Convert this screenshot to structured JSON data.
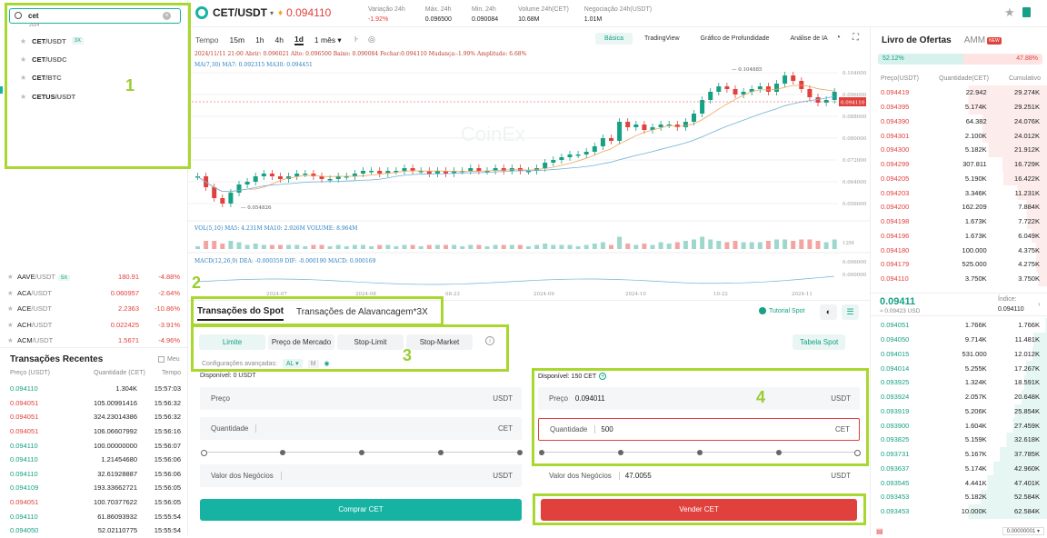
{
  "header": {
    "pair": "CET/USDT",
    "price": "0.094110",
    "stats": [
      {
        "label": "Variação 24h",
        "value": "-1.92%",
        "color": "red"
      },
      {
        "label": "Máx. 24h",
        "value": "0.096500",
        "color": ""
      },
      {
        "label": "Min. 24h",
        "value": "0.090084",
        "color": ""
      },
      {
        "label": "Volume 24h(CET)",
        "value": "10.68M",
        "color": ""
      },
      {
        "label": "Negociação 24h(USDT)",
        "value": "1.01M",
        "color": ""
      }
    ]
  },
  "search": {
    "value": "cet",
    "hint": "2024",
    "results": [
      {
        "base": "CET",
        "quote": "/USDT",
        "badge": "3X"
      },
      {
        "base": "CET",
        "quote": "/USDC",
        "badge": ""
      },
      {
        "base": "CET",
        "quote": "/BTC",
        "badge": ""
      },
      {
        "base": "CETUS",
        "quote": "/USDT",
        "badge": ""
      }
    ]
  },
  "markets": [
    {
      "pair": "AAVE",
      "quote": "/USDT",
      "badge": "5X",
      "price": "180.91",
      "change": "-4.88%"
    },
    {
      "pair": "ACA",
      "quote": "/USDT",
      "badge": "",
      "price": "0.060957",
      "change": "-2.64%"
    },
    {
      "pair": "ACE",
      "quote": "/USDT",
      "badge": "",
      "price": "2.2363",
      "change": "-10.86%"
    },
    {
      "pair": "ACH",
      "quote": "/USDT",
      "badge": "",
      "price": "0.022425",
      "change": "-3.91%"
    },
    {
      "pair": "ACM",
      "quote": "/USDT",
      "badge": "",
      "price": "1.5671",
      "change": "-4.96%"
    }
  ],
  "recent": {
    "title": "Transações Recentes",
    "mine": "Meu",
    "cols": [
      "Preço (USDT)",
      "Quantidade (CET)",
      "Tempo"
    ],
    "rows": [
      [
        "0.094110",
        "1.304K",
        "15:57:03",
        "g"
      ],
      [
        "0.094051",
        "105.00991416",
        "15:56:32",
        "r"
      ],
      [
        "0.094051",
        "324.23014386",
        "15:56:32",
        "r"
      ],
      [
        "0.094051",
        "106.06607992",
        "15:56:16",
        "r"
      ],
      [
        "0.094110",
        "100.00000000",
        "15:56:07",
        "g"
      ],
      [
        "0.094110",
        "1.21454680",
        "15:56:06",
        "g"
      ],
      [
        "0.094110",
        "32.61928887",
        "15:56:06",
        "g"
      ],
      [
        "0.094109",
        "193.33662721",
        "15:56:05",
        "g"
      ],
      [
        "0.094051",
        "100.70377622",
        "15:56:05",
        "r"
      ],
      [
        "0.094110",
        "61.86093932",
        "15:55:54",
        "g"
      ],
      [
        "0.094050",
        "52.02110775",
        "15:55:54",
        "g"
      ]
    ]
  },
  "chart": {
    "tabs_left": [
      "Tempo",
      "15m",
      "1h",
      "4h",
      "1d",
      "1 mês ▾"
    ],
    "tabs_right": [
      "Básica",
      "TradingView",
      "Gráfico de Profundidade",
      "Análise de IA"
    ],
    "info": "2024/11/11 21:00  Abrir: 0.096021  Alto: 0.096500  Baixo: 0.090084  Fechar:0.094110  Mudança:-1.99%  Amplitude: 6.68%",
    "ma": "MA(7,30)  MA7: 0.092315  MA30: 0.094451",
    "vol": "VOL(5,10)  MA5: 4.231M  MA10: 2.926M  VOLUME: 8.964M",
    "macd": "MACD(12,26,9)  DEA: -0.000359  DIF: -0.000190  MACD: 0.000169",
    "hi": "0.104885",
    "lo": "0.054826",
    "last": "0.094110",
    "watermark": "CoinEx",
    "volmax": "12M",
    "yticks": [
      "0.104000",
      "0.096000",
      "0.088000",
      "0.080000",
      "0.072000",
      "0.064000",
      "0.056000"
    ],
    "macdticks": [
      "0.006000",
      "0.000000"
    ],
    "xticks": [
      "2024-07",
      "2024-08",
      "08-23",
      "2024-09",
      "2024-10",
      "10-22",
      "2024-11"
    ]
  },
  "trade": {
    "tabs": [
      "Transações do Spot",
      "Transações de Alavancagem*3X"
    ],
    "tutorial": "Tutorial Spot",
    "order_types": [
      "Limite",
      "Preço de Mercado",
      "Stop-Limit",
      "Stop-Market"
    ],
    "advanced": "Configurações avançadas:",
    "adv_sel": "AL",
    "adv_m": "M",
    "table_btn": "Tabela Spot",
    "buy": {
      "avail": "Disponível: 0 USDT",
      "price_label": "Preço",
      "price_unit": "USDT",
      "qty_label": "Quantidade",
      "qty_unit": "CET",
      "value_label": "Valor dos Negócios",
      "value_unit": "USDT",
      "button": "Comprar CET"
    },
    "sell": {
      "avail": "Disponível: 150 CET",
      "price_label": "Preço",
      "price": "0.094011",
      "price_unit": "USDT",
      "qty_label": "Quantidade",
      "qty": "500",
      "qty_unit": "CET",
      "value_label": "Valor dos Negócios",
      "value": "47.0055",
      "value_unit": "USDT",
      "button": "Vender CET"
    }
  },
  "orderbook": {
    "title": "Livro de Ofertas",
    "amm": "AMM",
    "amm_badge": "NEW",
    "buy_pct": "52.12%",
    "sell_pct": "47.88%",
    "cols": [
      "Preço(USDT)",
      "Quantidade(CET)",
      "Cumulativo"
    ],
    "asks": [
      [
        "0.094419",
        "22.942",
        "29.274K"
      ],
      [
        "0.094395",
        "5.174K",
        "29.251K"
      ],
      [
        "0.094390",
        "64.382",
        "24.076K"
      ],
      [
        "0.094301",
        "2.100K",
        "24.012K"
      ],
      [
        "0.094300",
        "5.182K",
        "21.912K"
      ],
      [
        "0.094299",
        "307.811",
        "16.729K"
      ],
      [
        "0.094205",
        "5.190K",
        "16.422K"
      ],
      [
        "0.094203",
        "3.346K",
        "11.231K"
      ],
      [
        "0.094200",
        "162.209",
        "7.884K"
      ],
      [
        "0.094198",
        "1.673K",
        "7.722K"
      ],
      [
        "0.094196",
        "1.673K",
        "6.049K"
      ],
      [
        "0.094180",
        "100.000",
        "4.375K"
      ],
      [
        "0.094179",
        "525.000",
        "4.275K"
      ],
      [
        "0.094110",
        "3.750K",
        "3.750K"
      ]
    ],
    "mid": "0.09411",
    "mid_sub": "≈ 0.09423  USD",
    "index_label": "Índice:",
    "index": "0.094110",
    "bids": [
      [
        "0.094051",
        "1.766K",
        "1.766K"
      ],
      [
        "0.094050",
        "9.714K",
        "11.481K"
      ],
      [
        "0.094015",
        "531.000",
        "12.012K"
      ],
      [
        "0.094014",
        "5.255K",
        "17.267K"
      ],
      [
        "0.093925",
        "1.324K",
        "18.591K"
      ],
      [
        "0.093924",
        "2.057K",
        "20.648K"
      ],
      [
        "0.093919",
        "5.206K",
        "25.854K"
      ],
      [
        "0.093900",
        "1.604K",
        "27.459K"
      ],
      [
        "0.093825",
        "5.159K",
        "32.618K"
      ],
      [
        "0.093731",
        "5.167K",
        "37.785K"
      ],
      [
        "0.093637",
        "5.174K",
        "42.960K"
      ],
      [
        "0.093545",
        "4.441K",
        "47.401K"
      ],
      [
        "0.093453",
        "5.182K",
        "52.584K"
      ],
      [
        "0.093453",
        "10.000K",
        "62.584K"
      ]
    ],
    "footer": "0.00000001"
  },
  "annotations": [
    "1",
    "2",
    "3",
    "4"
  ],
  "colors": {
    "green": "#16a085",
    "red": "#e0413d",
    "accent": "#16b3a3",
    "highlight": "#a8d82f"
  }
}
